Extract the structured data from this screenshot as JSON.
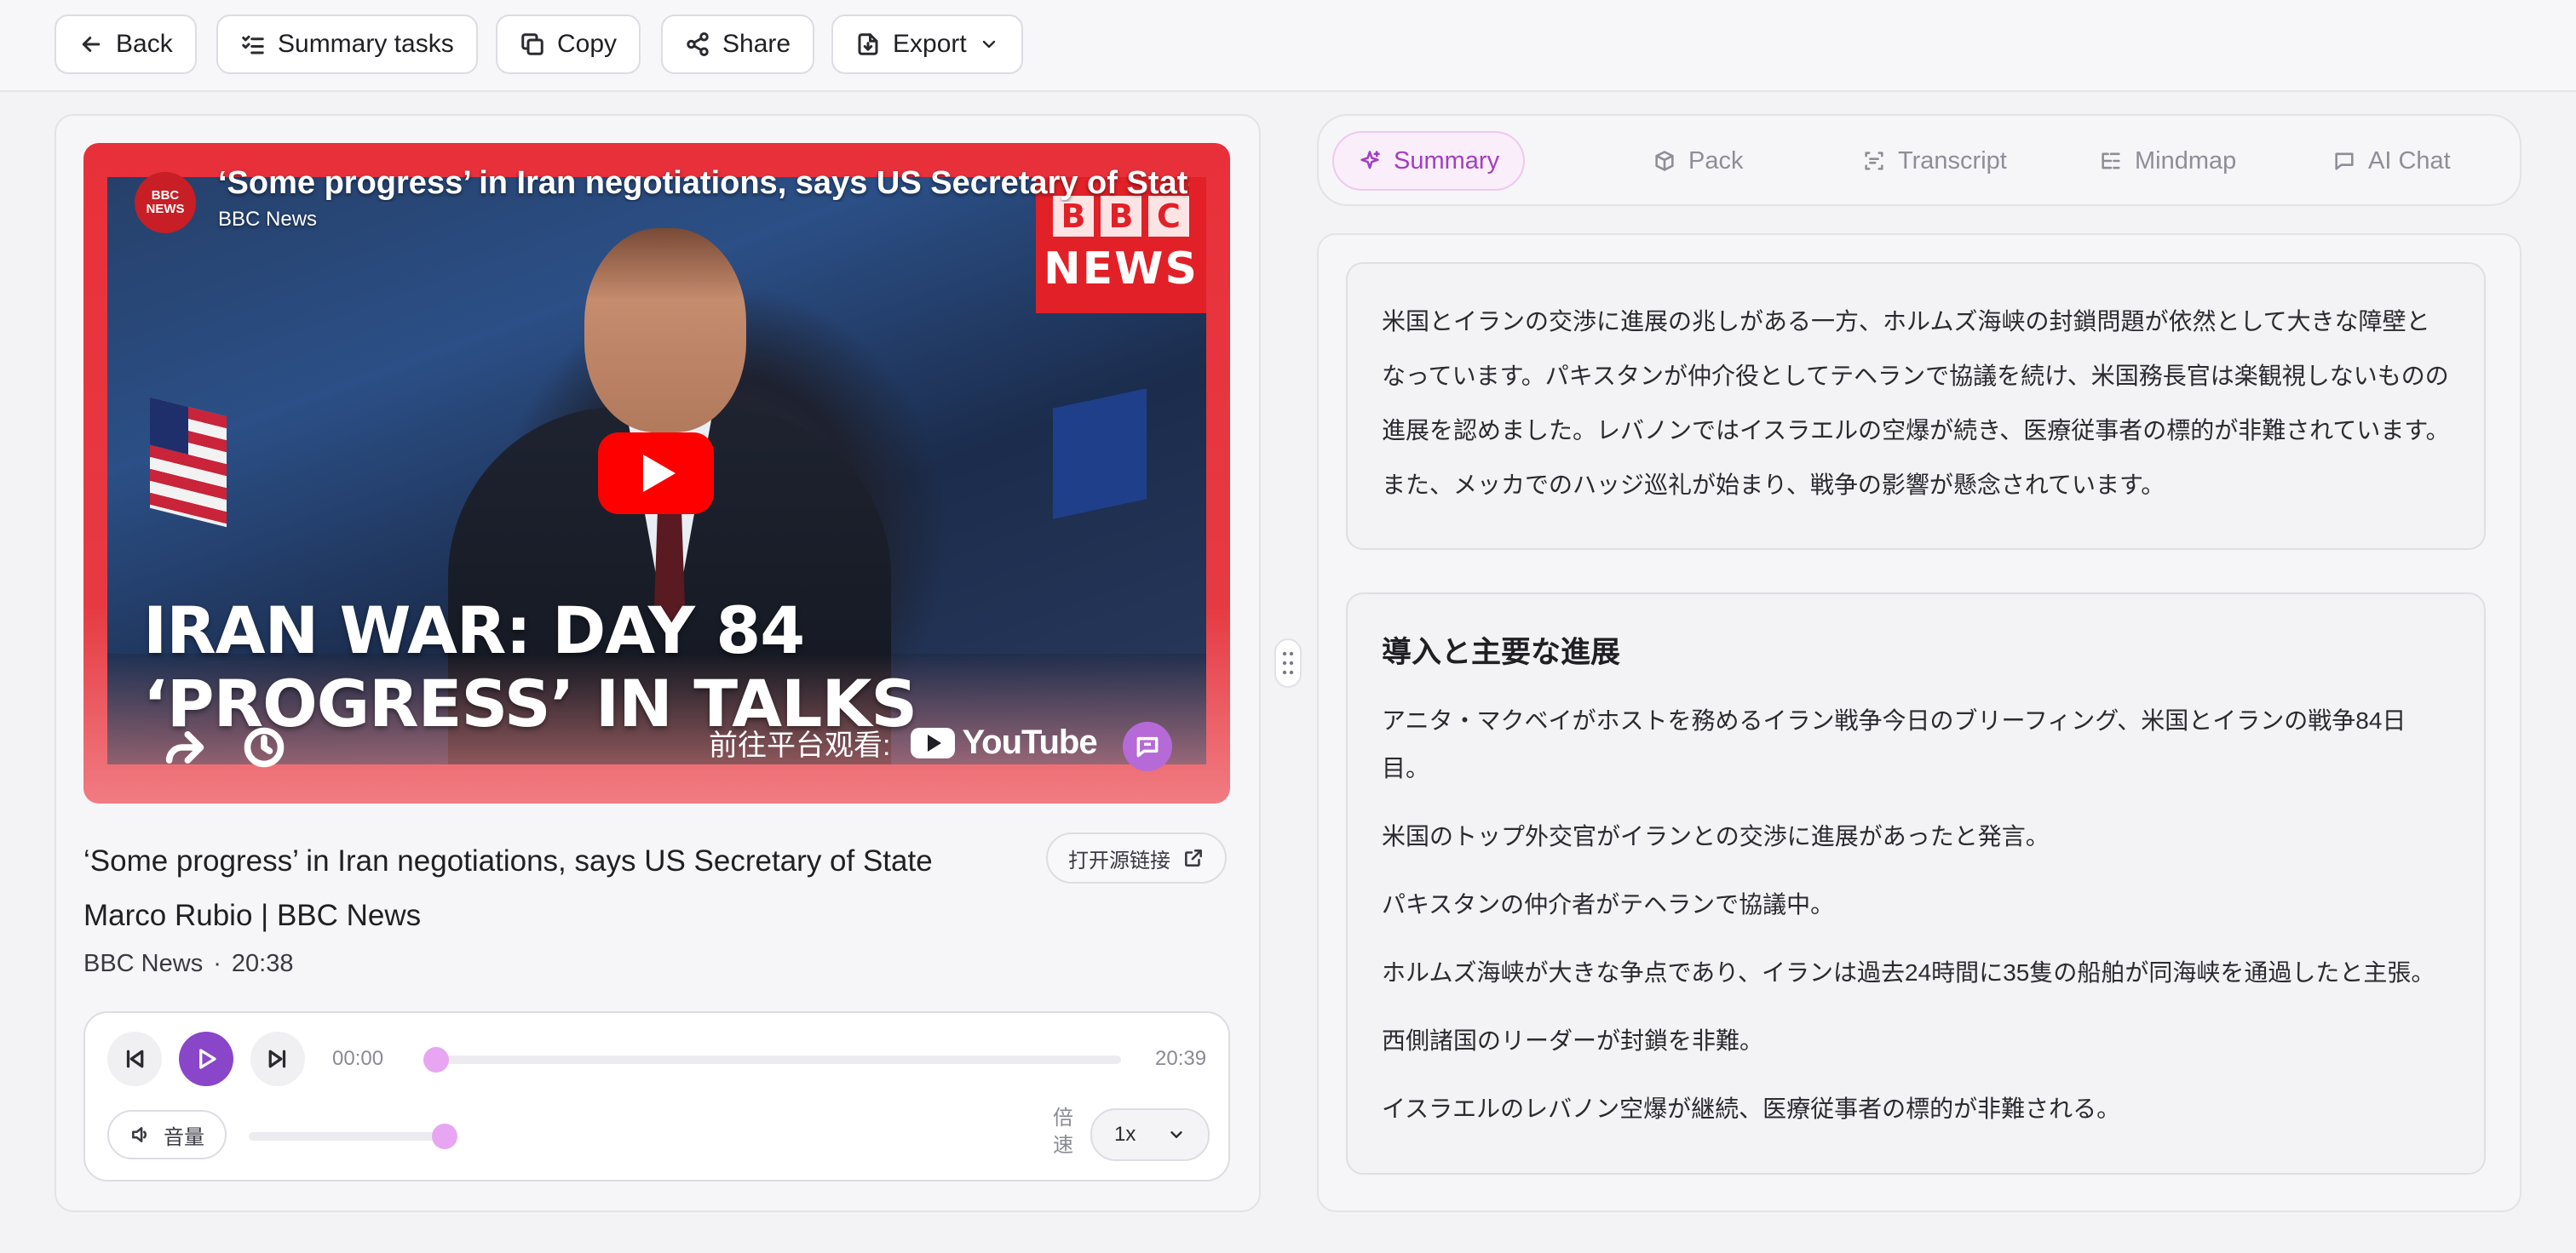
{
  "toolbar": {
    "back": "Back",
    "summary_tasks": "Summary tasks",
    "copy": "Copy",
    "share": "Share",
    "export": "Export"
  },
  "video": {
    "yt_title": "‘Some progress’ in Iran negotiations, says US Secretary of State Marco Rubio | BBC News",
    "channel_avatar_top": "BBC",
    "channel_avatar_bottom": "NEWS",
    "channel": "BBC News",
    "bbc_letters": [
      "B",
      "B",
      "C"
    ],
    "bbc_news_word": "NEWS",
    "overlay_line1": "IRAN WAR: DAY 84",
    "overlay_line2": "‘PROGRESS’ IN TALKS",
    "watch_on": "前往平台观看:",
    "youtube_word": "YouTube"
  },
  "details": {
    "title": "‘Some progress’ in Iran negotiations, says US Secretary of State Marco Rubio | BBC News",
    "open_source": "打开源链接",
    "channel": "BBC News",
    "separator": "·",
    "duration": "20:38"
  },
  "player": {
    "current_time": "00:00",
    "total_time": "20:39",
    "progress": 0.0,
    "volume_label": "音量",
    "volume_level": 1.0,
    "speed_label": "倍速",
    "speed_value": "1x"
  },
  "tabs": [
    {
      "label": "Summary",
      "icon": "sparkle-icon",
      "active": true
    },
    {
      "label": "Pack",
      "icon": "box-icon",
      "active": false
    },
    {
      "label": "Transcript",
      "icon": "transcript-icon",
      "active": false
    },
    {
      "label": "Mindmap",
      "icon": "mindmap-icon",
      "active": false
    },
    {
      "label": "AI Chat",
      "icon": "chat-icon",
      "active": false
    }
  ],
  "summary": {
    "overview": "米国とイランの交渉に進展の兆しがある一方、ホルムズ海峡の封鎖問題が依然として大きな障壁となっています。パキスタンが仲介役としてテヘランで協議を続け、米国務長官は楽観視しないものの進展を認めました。レバノンではイスラエルの空爆が続き、医療従事者の標的が非難されています。また、メッカでのハッジ巡礼が始まり、戦争の影響が懸念されています。",
    "section_title": "導入と主要な進展",
    "bullets": [
      "アニタ・マクベイがホストを務めるイラン戦争今日のブリーフィング、米国とイランの戦争84日目。",
      "米国のトップ外交官がイランとの交渉に進展があったと発言。",
      "パキスタンの仲介者がテヘランで協議中。",
      "ホルムズ海峡が大きな争点であり、イランは過去24時間に35隻の船舶が同海峡を通過したと主張。",
      "西側諸国のリーダーが封鎖を非難。",
      "イスラエルのレバノン空爆が継続、医療従事者の標的が非難される。"
    ]
  },
  "colors": {
    "accent": "#8a46c9",
    "tab_active_text": "#a23ec2",
    "knob": "#e8a6f2",
    "youtube_red": "#ff0000",
    "bbc_red": "#e12027"
  }
}
